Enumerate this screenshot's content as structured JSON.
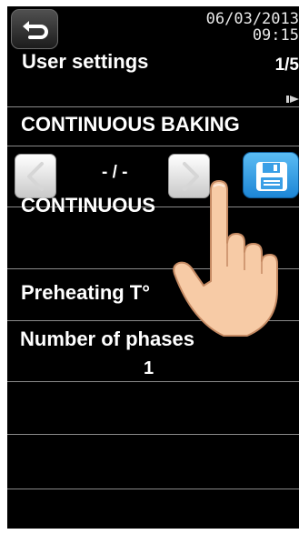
{
  "header": {
    "date": "06/03/2013",
    "time": "09:15",
    "back_icon": "return-arrow-icon"
  },
  "page": {
    "title": "User settings",
    "page_indicator": "1/5"
  },
  "program": {
    "name": "CONTINUOUS BAKING"
  },
  "nav": {
    "period": "- / -",
    "prev_icon": "chevron-left-icon",
    "next_icon": "chevron-right-icon",
    "save_icon": "floppy-disk-icon"
  },
  "settings": {
    "mode": "CONTINUOUS",
    "preheating_label": "Preheating T°",
    "phases_label": "Number of phases",
    "phases_value": "1"
  },
  "colors": {
    "background": "#000000",
    "save_button": "#2a98e4",
    "separator": "#8a8a8a"
  }
}
